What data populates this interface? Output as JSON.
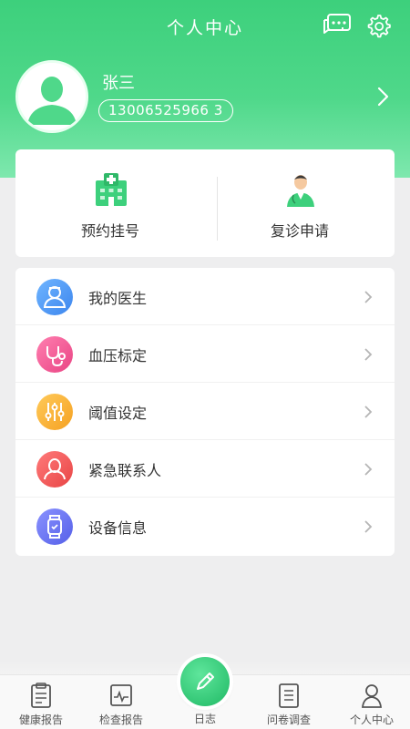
{
  "header": {
    "title": "个人中心",
    "icons": [
      "message-icon",
      "settings-gear-icon"
    ]
  },
  "profile": {
    "name": "张三",
    "phone": "13006525966 3"
  },
  "quick_actions": [
    {
      "label": "预约挂号",
      "icon": "hospital-icon"
    },
    {
      "label": "复诊申请",
      "icon": "doctor-icon"
    }
  ],
  "menu": [
    {
      "label": "我的医生",
      "icon": "doctor-badge-icon",
      "color": "#4a9af5"
    },
    {
      "label": "血压标定",
      "icon": "stethoscope-icon",
      "color": "#f25a94"
    },
    {
      "label": "阈值设定",
      "icon": "sliders-icon",
      "color": "#f9b43c"
    },
    {
      "label": "紧急联系人",
      "icon": "contact-person-icon",
      "color": "#f25a5a"
    },
    {
      "label": "设备信息",
      "icon": "smartwatch-icon",
      "color": "#6b76f0"
    }
  ],
  "tabs": [
    {
      "label": "健康报告",
      "icon": "health-report-icon"
    },
    {
      "label": "检查报告",
      "icon": "check-report-icon"
    },
    {
      "label": "日志",
      "icon": "pencil-icon"
    },
    {
      "label": "问卷调查",
      "icon": "survey-icon"
    },
    {
      "label": "个人中心",
      "icon": "person-icon"
    }
  ],
  "colors": {
    "brand": "#3dd07c",
    "tab_active": "#3dd07c"
  }
}
